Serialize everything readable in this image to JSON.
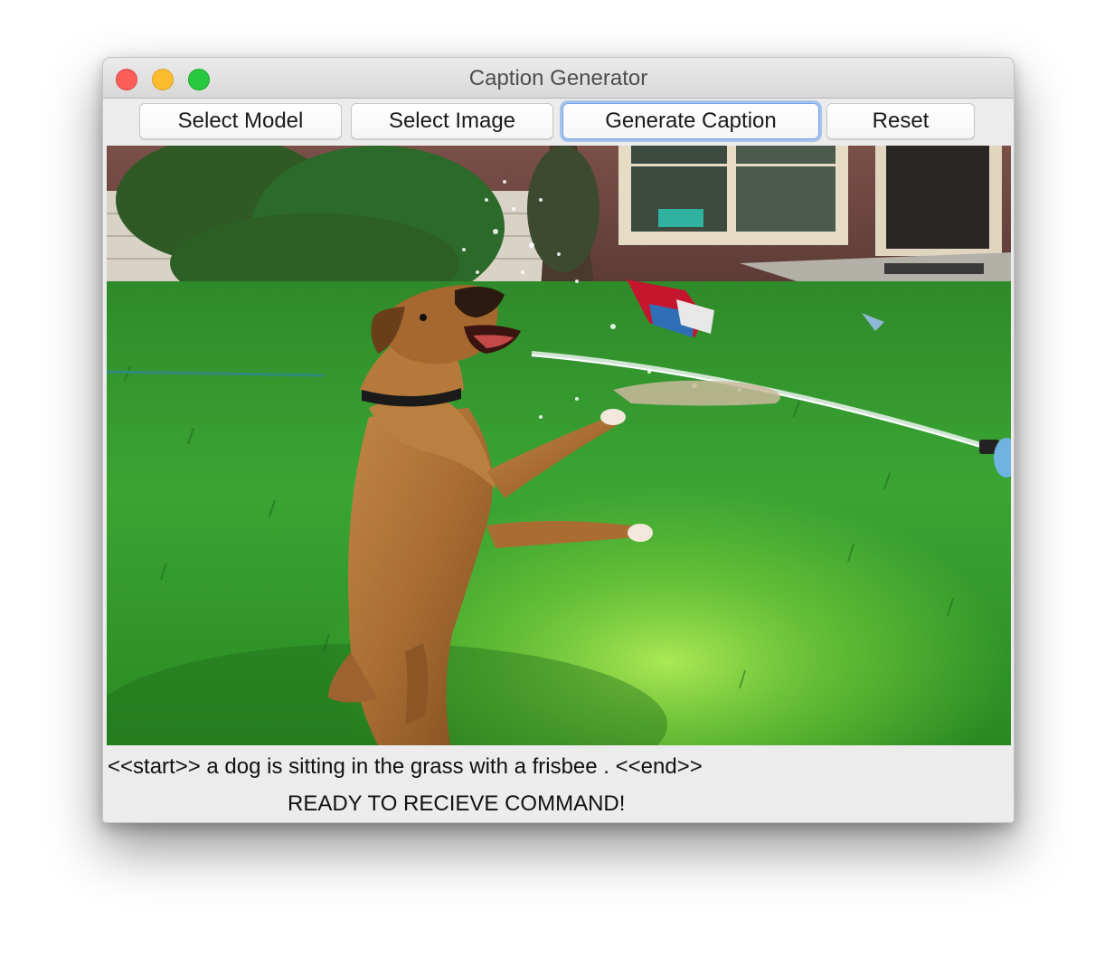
{
  "window": {
    "title": "Caption Generator"
  },
  "toolbar": {
    "select_model_label": "Select Model",
    "select_image_label": "Select Image",
    "generate_caption_label": "Generate Caption",
    "reset_label": "Reset",
    "focused_button": "Generate Caption"
  },
  "image": {
    "subject": "boxer dog jumping at water spray from hose on green lawn"
  },
  "output": {
    "caption": "<<start>> a dog is sitting in the grass with a frisbee . <<end>>",
    "status": "READY TO RECIEVE COMMAND!"
  },
  "colors": {
    "close": "#fc5f57",
    "minimize": "#fdbc2e",
    "maximize": "#28c840",
    "focus_ring": "#6ea3e9"
  },
  "icons": [
    "close-icon",
    "minimize-icon",
    "maximize-icon"
  ]
}
